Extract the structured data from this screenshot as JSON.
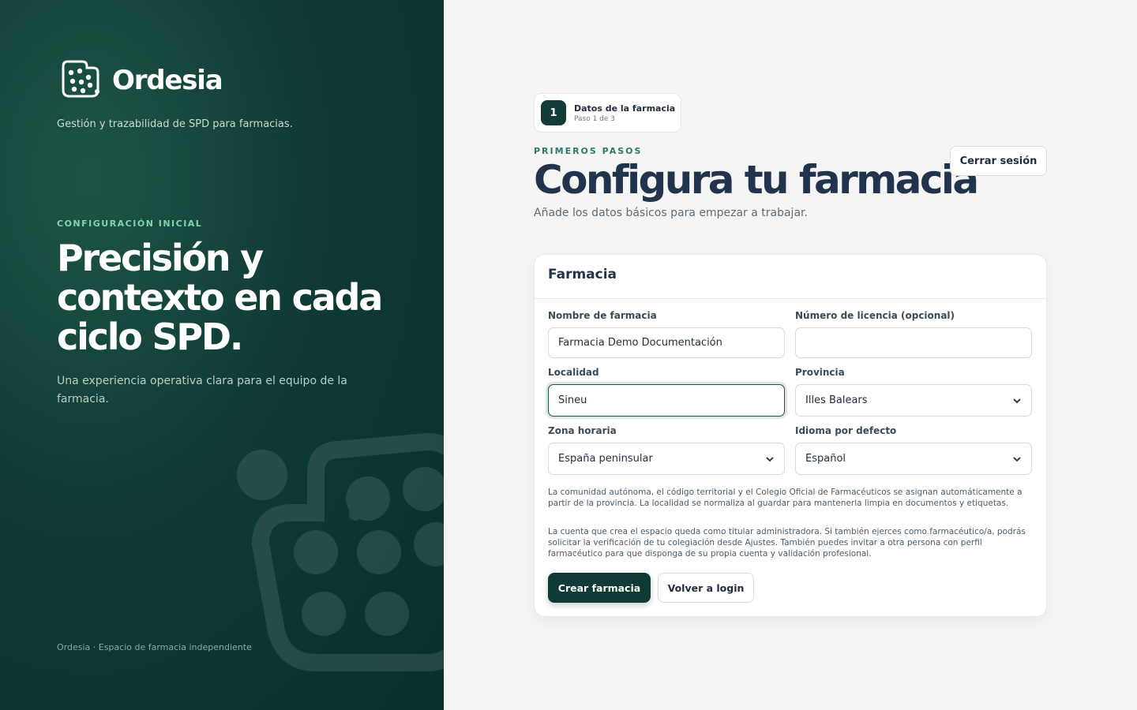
{
  "brand": {
    "name": "Ordesia",
    "logo_icon": "dots-grid-logo-icon"
  },
  "hero": {
    "tagline": "Gestión y trazabilidad de SPD para farmacias.",
    "eyebrow": "CONFIGURACIÓN INICIAL",
    "title": "Precisión y contexto en cada ciclo SPD.",
    "description": "Una experiencia operativa clara para el equipo de la farmacia.",
    "footer": "Ordesia · Espacio de farmacia independiente"
  },
  "stepper": {
    "number": "1",
    "title": "Datos de la farmacia",
    "subtitle": "Paso 1 de 3"
  },
  "header": {
    "eyebrow": "PRIMEROS PASOS",
    "title": "Configura tu farmacia",
    "subtitle": "Añade los datos básicos para empezar a trabajar.",
    "logout_label": "Cerrar sesión"
  },
  "form": {
    "section_title": "Farmacia",
    "pharmacy_name": {
      "label": "Nombre de farmacia",
      "value": "Farmacia Demo Documentación",
      "placeholder": ""
    },
    "license_number": {
      "label": "Número de licencia (opcional)",
      "value": "",
      "placeholder": ""
    },
    "locality": {
      "label": "Localidad",
      "value": "Sineu",
      "placeholder": ""
    },
    "province": {
      "label": "Provincia",
      "selected": "Illes Balears"
    },
    "timezone": {
      "label": "Zona horaria",
      "selected": "España peninsular"
    },
    "language": {
      "label": "Idioma por defecto",
      "selected": "Español"
    },
    "note_1": "La comunidad autónoma, el código territorial y el Colegio Oficial de Farmacéuticos se asignan automáticamente a partir de la provincia. La localidad se normaliza al guardar para mantenerla limpia en documentos y etiquetas.",
    "note_2": "La cuenta que crea el espacio queda como titular administradora. Si también ejerces como farmacéutico/a, podrás solicitar la verificación de tu colegiación desde Ajustes. También puedes invitar a otra persona con perfil farmacéutico para que disponga de su propia cuenta y validación profesional.",
    "submit_label": "Crear farmacia",
    "back_label": "Volver a login"
  },
  "colors": {
    "accent": "#0f3a35",
    "eyebrow": "#2c7a6b",
    "hero_eyebrow": "#7fd3b1",
    "title": "#22344d"
  }
}
